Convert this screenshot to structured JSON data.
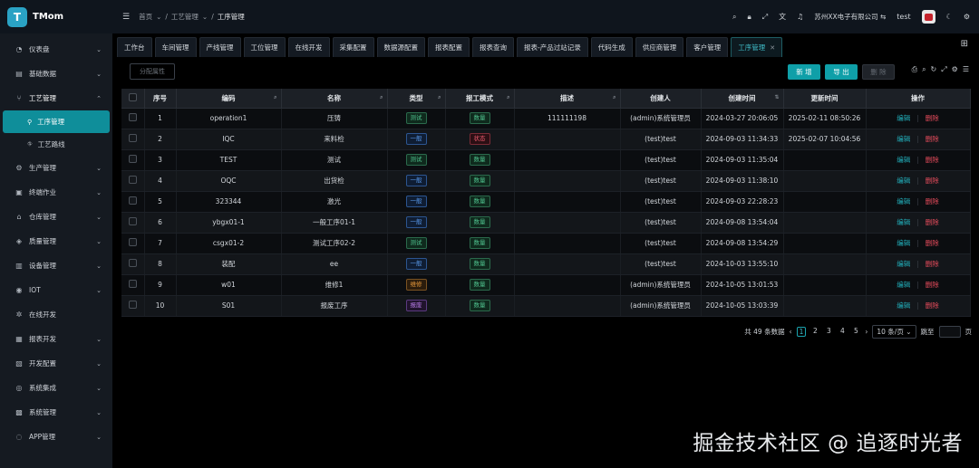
{
  "app": {
    "logo_letter": "T",
    "logo_text": "TMom"
  },
  "sidebar": {
    "items": [
      {
        "label": "仪表盘",
        "icon": "dashboard-icon",
        "glyph": "◔"
      },
      {
        "label": "基础数据",
        "icon": "database-icon",
        "glyph": "▤"
      },
      {
        "label": "工艺管理",
        "icon": "process-icon",
        "glyph": "⑂"
      },
      {
        "label": "生产管理",
        "icon": "production-icon",
        "glyph": "⚙"
      },
      {
        "label": "终端作业",
        "icon": "terminal-icon",
        "glyph": "▣"
      },
      {
        "label": "仓库管理",
        "icon": "warehouse-icon",
        "glyph": "⌂"
      },
      {
        "label": "质量管理",
        "icon": "quality-icon",
        "glyph": "◈"
      },
      {
        "label": "设备管理",
        "icon": "device-icon",
        "glyph": "▥"
      },
      {
        "label": "IOT",
        "icon": "iot-icon",
        "glyph": "◉"
      },
      {
        "label": "在线开发",
        "icon": "code-icon",
        "glyph": "✲"
      },
      {
        "label": "报表开发",
        "icon": "report-icon",
        "glyph": "▦"
      },
      {
        "label": "开发配置",
        "icon": "config-icon",
        "glyph": "▧"
      },
      {
        "label": "系统集成",
        "icon": "integration-icon",
        "glyph": "◎"
      },
      {
        "label": "系统管理",
        "icon": "system-icon",
        "glyph": "▩"
      },
      {
        "label": "APP管理",
        "icon": "app-icon",
        "glyph": "◌"
      }
    ],
    "subitems": [
      {
        "label": "工序管理",
        "icon": "process-step-icon",
        "glyph": "⚲"
      },
      {
        "label": "工艺路线",
        "icon": "route-icon",
        "glyph": "⛗"
      }
    ]
  },
  "header": {
    "breadcrumb": [
      "首页",
      "工艺管理",
      "工序管理"
    ],
    "company": "苏州XX电子有限公司",
    "user": "test"
  },
  "tabs": [
    "工作台",
    "车间管理",
    "产线管理",
    "工位管理",
    "在线开发",
    "采集配置",
    "数据源配置",
    "报表配置",
    "报表查询",
    "报表-产品过站记录",
    "代码生成",
    "供应商管理",
    "客户管理",
    "工序管理"
  ],
  "toolbar": {
    "assign": "分配属性",
    "new": "新 增",
    "export": "导 出",
    "delete": "删 除"
  },
  "table": {
    "headers": [
      "序号",
      "编码",
      "名称",
      "类型",
      "报工模式",
      "描述",
      "创建人",
      "创建时间",
      "更新时间",
      "操作"
    ],
    "edit_label": "编辑",
    "delete_label": "删除",
    "rows": [
      {
        "no": "1",
        "code": "operation1",
        "name": "压铸",
        "type": "测试",
        "type_color": "green",
        "mode": "数量",
        "mode_color": "green",
        "desc": "111111198",
        "creator": "(admin)系统管理员",
        "created": "2024-03-27 20:06:05",
        "updated": "2025-02-11 08:50:26"
      },
      {
        "no": "2",
        "code": "IQC",
        "name": "来料检",
        "type": "一般",
        "type_color": "blue",
        "mode": "状态",
        "mode_color": "red",
        "desc": "",
        "creator": "(test)test",
        "created": "2024-09-03 11:34:33",
        "updated": "2025-02-07 10:04:56"
      },
      {
        "no": "3",
        "code": "TEST",
        "name": "测试",
        "type": "测试",
        "type_color": "green",
        "mode": "数量",
        "mode_color": "green",
        "desc": "",
        "creator": "(test)test",
        "created": "2024-09-03 11:35:04",
        "updated": ""
      },
      {
        "no": "4",
        "code": "OQC",
        "name": "出货检",
        "type": "一般",
        "type_color": "blue",
        "mode": "数量",
        "mode_color": "green",
        "desc": "",
        "creator": "(test)test",
        "created": "2024-09-03 11:38:10",
        "updated": ""
      },
      {
        "no": "5",
        "code": "323344",
        "name": "激光",
        "type": "一般",
        "type_color": "blue",
        "mode": "数量",
        "mode_color": "green",
        "desc": "",
        "creator": "(test)test",
        "created": "2024-09-03 22:28:23",
        "updated": ""
      },
      {
        "no": "6",
        "code": "ybgx01-1",
        "name": "一般工序01-1",
        "type": "一般",
        "type_color": "blue",
        "mode": "数量",
        "mode_color": "green",
        "desc": "",
        "creator": "(test)test",
        "created": "2024-09-08 13:54:04",
        "updated": ""
      },
      {
        "no": "7",
        "code": "csgx01-2",
        "name": "测试工序02-2",
        "type": "测试",
        "type_color": "green",
        "mode": "数量",
        "mode_color": "green",
        "desc": "",
        "creator": "(test)test",
        "created": "2024-09-08 13:54:29",
        "updated": ""
      },
      {
        "no": "8",
        "code": "装配",
        "name": "ee",
        "type": "一般",
        "type_color": "blue",
        "mode": "数量",
        "mode_color": "green",
        "desc": "",
        "creator": "(test)test",
        "created": "2024-10-03 13:55:10",
        "updated": ""
      },
      {
        "no": "9",
        "code": "w01",
        "name": "维修1",
        "type": "维修",
        "type_color": "orange",
        "mode": "数量",
        "mode_color": "green",
        "desc": "",
        "creator": "(admin)系统管理员",
        "created": "2024-10-05 13:01:53",
        "updated": ""
      },
      {
        "no": "10",
        "code": "S01",
        "name": "报废工序",
        "type": "报废",
        "type_color": "purple",
        "mode": "数量",
        "mode_color": "green",
        "desc": "",
        "creator": "(admin)系统管理员",
        "created": "2024-10-05 13:03:39",
        "updated": ""
      }
    ]
  },
  "pagination": {
    "total": "共 49 条数据",
    "pages": [
      "1",
      "2",
      "3",
      "4",
      "5"
    ],
    "current_index": 0,
    "page_size": "10 条/页",
    "jump_label": "跳至",
    "page_suffix": "页"
  },
  "watermark": "掘金技术社区 @ 追逐时光者"
}
